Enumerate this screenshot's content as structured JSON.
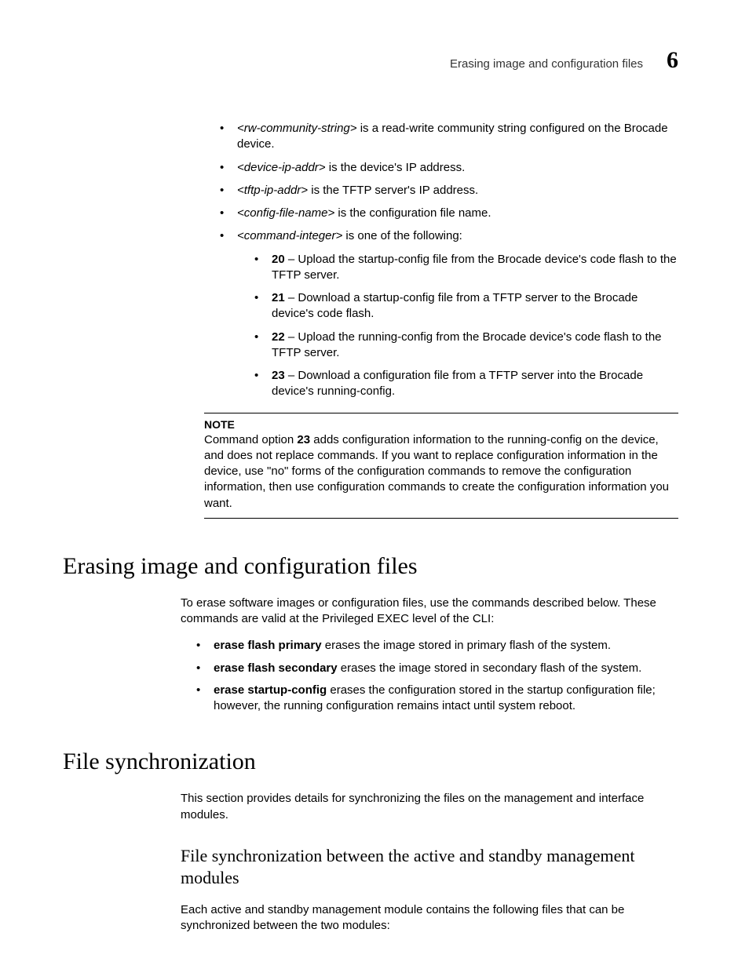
{
  "header": {
    "title": "Erasing image and configuration files",
    "chapter": "6"
  },
  "params": {
    "items": [
      {
        "term": "<rw-community-string>",
        "desc": " is a read-write community string configured on the Brocade device."
      },
      {
        "term": "<device-ip-addr>",
        "desc": " is the device's IP address."
      },
      {
        "term": "<tftp-ip-addr>",
        "desc": " is the TFTP server's IP address."
      },
      {
        "term": "<config-file-name>",
        "desc": " is the configuration file name."
      },
      {
        "term": "<command-integer>",
        "desc": " is one of the following:"
      }
    ],
    "sub": [
      {
        "num": "20",
        "desc": " – Upload the startup-config file from the Brocade device's code flash to the TFTP server."
      },
      {
        "num": "21",
        "desc": " – Download a startup-config file from a TFTP server to the Brocade device's code flash."
      },
      {
        "num": "22",
        "desc": " – Upload the running-config from the Brocade device's code flash to the TFTP server."
      },
      {
        "num": "23",
        "desc": " – Download a configuration file from a TFTP server into the Brocade device's running-config."
      }
    ]
  },
  "note": {
    "label": "NOTE",
    "pre": "Command option ",
    "opt": "23",
    "post": " adds configuration information to the running-config on the device, and does not replace commands. If you want to replace configuration information in the device, use \"no\" forms of the configuration commands to remove the configuration information, then use configuration commands to create the configuration information you want."
  },
  "erase": {
    "heading": "Erasing image and configuration files",
    "intro": "To erase software images or configuration files, use the commands described below. These commands are valid at the Privileged EXEC level of the CLI:",
    "items": [
      {
        "cmd": "erase flash primary",
        "desc": " erases the image stored in primary flash of the system."
      },
      {
        "cmd": "erase flash secondary",
        "desc": " erases the image stored in secondary flash of the system."
      },
      {
        "cmd": "erase startup-config",
        "desc": " erases the configuration stored in the startup configuration file; however, the running configuration remains intact until system reboot."
      }
    ]
  },
  "sync": {
    "heading": "File synchronization",
    "intro": "This section provides details for synchronizing the files on the management and interface modules.",
    "subheading": "File synchronization between the active and standby management modules",
    "body": "Each active and standby management module contains the following files that can be synchronized between the two modules:"
  }
}
